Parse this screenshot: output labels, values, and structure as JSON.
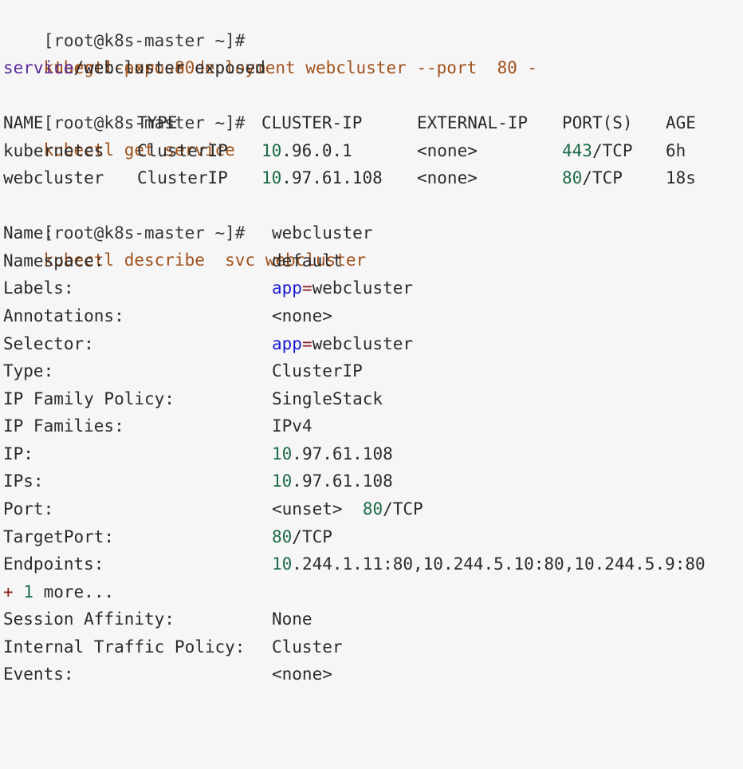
{
  "terminal": {
    "prompt": "[root@k8s-master ~]#",
    "cmd1": {
      "line1": "kubectl expose deployment webcluster --port  80 -",
      "line2": "-target-port 80"
    },
    "exposed_resource": "service",
    "exposed_rest": "/webcluster exposed",
    "cmd2": "kubectl get service",
    "service_table": {
      "headers": [
        "NAME",
        "TYPE",
        "CLUSTER-IP",
        "EXTERNAL-IP",
        "PORT(S)",
        "AGE"
      ],
      "rows": [
        {
          "name": "kubernetes",
          "type": "ClusterIP",
          "ip_a": "10",
          "ip_b": ".96.0.1",
          "external": "<none>",
          "port_num": "443",
          "port_proto": "/TCP",
          "age": "6h"
        },
        {
          "name": "webcluster",
          "type": "ClusterIP",
          "ip_a": "10",
          "ip_b": ".97.61.108",
          "external": "<none>",
          "port_num": "80",
          "port_proto": "/TCP",
          "age": "18s"
        }
      ]
    },
    "cmd3": "kubectl describe  svc webcluster",
    "describe": {
      "name_k": "Name:",
      "name_v": "webcluster",
      "ns_k": "Namespace:",
      "ns_v": "default",
      "labels_k": "Labels:",
      "labels_key": "app",
      "labels_eq": "=",
      "labels_val": "webcluster",
      "ann_k": "Annotations:",
      "ann_v": "<none>",
      "sel_k": "Selector:",
      "sel_key": "app",
      "sel_eq": "=",
      "sel_val": "webcluster",
      "type_k": "Type:",
      "type_v": "ClusterIP",
      "ifp_k": "IP Family Policy:",
      "ifp_v": "SingleStack",
      "ipf_k": "IP Families:",
      "ipf_v": "IPv4",
      "ip_k": "IP:",
      "ip_a": "10",
      "ip_b": ".97.61.108",
      "ips_k": "IPs:",
      "ips_a": "10",
      "ips_b": ".97.61.108",
      "port_k": "Port:",
      "port_unset": "<unset>",
      "port_num": "80",
      "port_proto": "/TCP",
      "tport_k": "TargetPort:",
      "tport_num": "80",
      "tport_proto": "/TCP",
      "ep_k": "Endpoints:",
      "ep_a": "10",
      "ep_b": ".244.1.11:80,10.244.5.10:80,10.244.5.9:80",
      "more_plus": "+",
      "more_num": "1",
      "more_text": " more...",
      "sa_k": "Session Affinity:",
      "sa_v": "None",
      "itp_k": "Internal Traffic Policy:",
      "itp_v": "Cluster",
      "ev_k": "Events:",
      "ev_v": "<none>"
    },
    "colors": {
      "background": "#f6f6f6",
      "command": "#a0521c",
      "number": "#1c6b47",
      "label_key": "#1a1ad0",
      "keyword": "#5a2d9a"
    }
  }
}
